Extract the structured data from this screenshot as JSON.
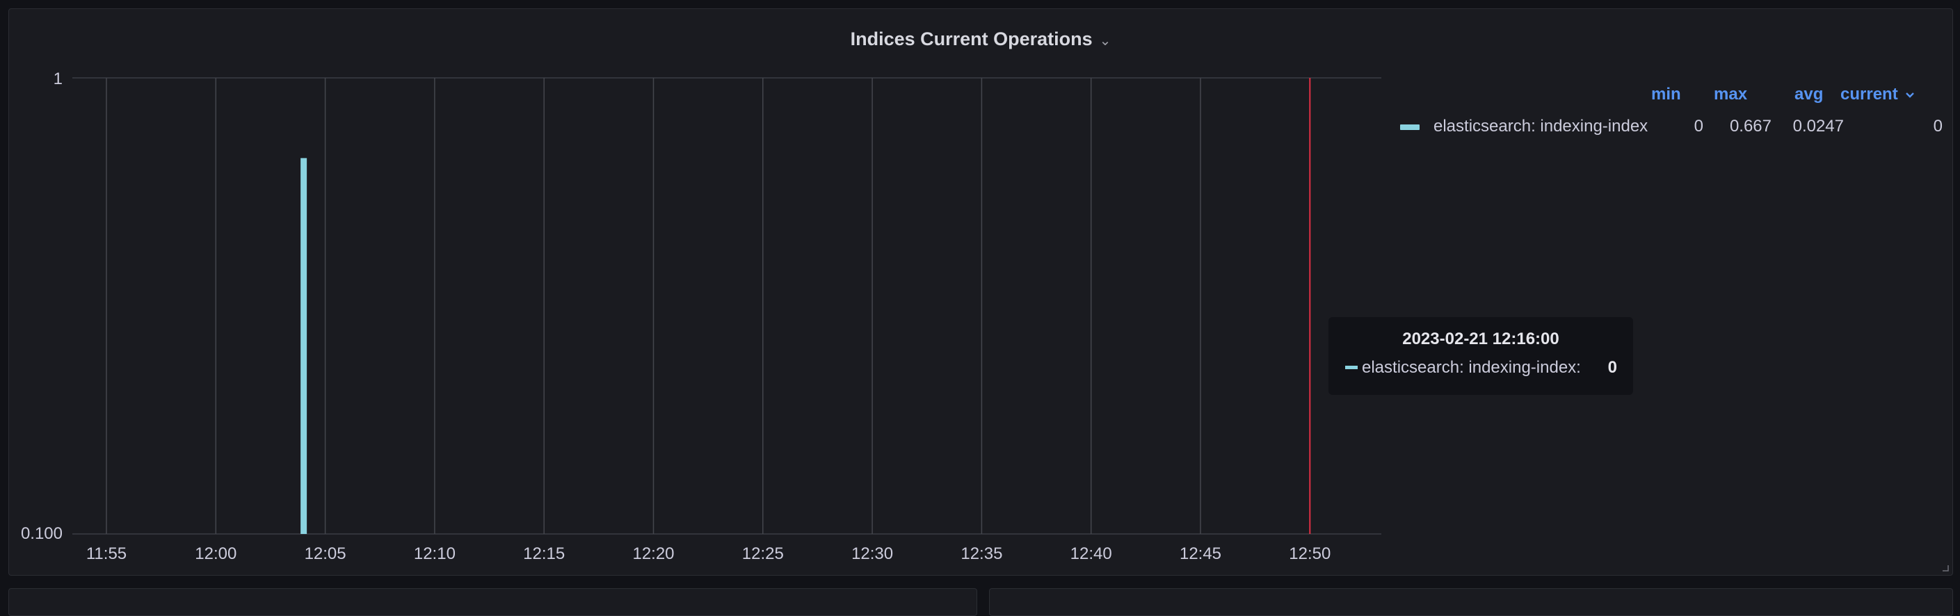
{
  "panel": {
    "title": "Indices Current Operations",
    "title_menu_icon": "chevron-down-icon"
  },
  "chart_data": {
    "type": "bar",
    "y_scale": "log",
    "ylim": [
      0.1,
      1
    ],
    "y_ticks": [
      "1",
      "0.100"
    ],
    "x_ticks": [
      "11:55",
      "12:00",
      "12:05",
      "12:10",
      "12:15",
      "12:20",
      "12:25",
      "12:30",
      "12:35",
      "12:40",
      "12:45",
      "12:50"
    ],
    "series": [
      {
        "name": "elasticsearch: indexing-index",
        "color": "#8ad3e0",
        "points": [
          {
            "x": "12:04",
            "y": 0.667
          }
        ]
      }
    ],
    "cursor_time": "12:50",
    "cursor_color": "#e02f44"
  },
  "legend": {
    "headers": {
      "min": "min",
      "max": "max",
      "avg": "avg",
      "current": "current"
    },
    "sort_icon": "chevron-down-icon",
    "rows": [
      {
        "name": "elasticsearch: indexing-index",
        "min": "0",
        "max": "0.667",
        "avg": "0.0247",
        "current": "0",
        "color": "#8ad3e0"
      }
    ]
  },
  "tooltip": {
    "time": "2023-02-21 12:16:00",
    "series_name": "elasticsearch: indexing-index:",
    "value": "0"
  }
}
